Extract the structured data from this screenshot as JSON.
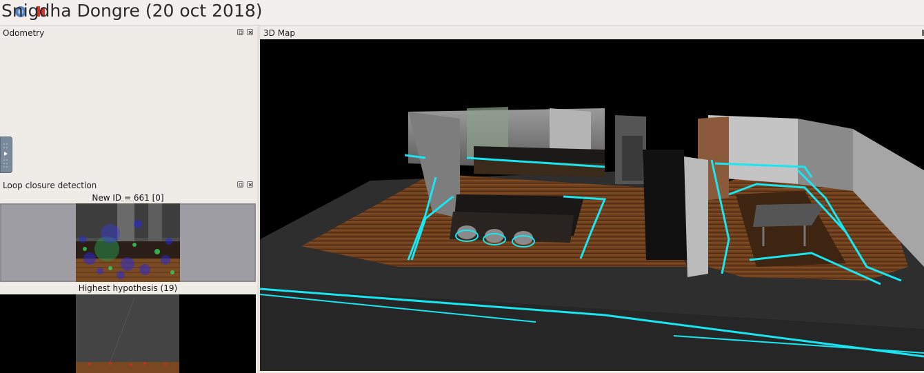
{
  "window": {
    "title": "Snigdha Dongre (20 oct 2018)",
    "logo_icon": "rtabmap-logo-icon"
  },
  "panels": {
    "odometry": {
      "title": "Odometry"
    },
    "loop_closure": {
      "title": "Loop closure detection",
      "new_id_caption": "New ID = 661 [0]",
      "hypothesis_caption": "Highest hypothesis (19)"
    },
    "map3d": {
      "title": "3D Map"
    }
  },
  "colors": {
    "accent_cyan": "#19e6f0",
    "floor_wood": "#6b3d1c",
    "background": "#efebe7"
  }
}
